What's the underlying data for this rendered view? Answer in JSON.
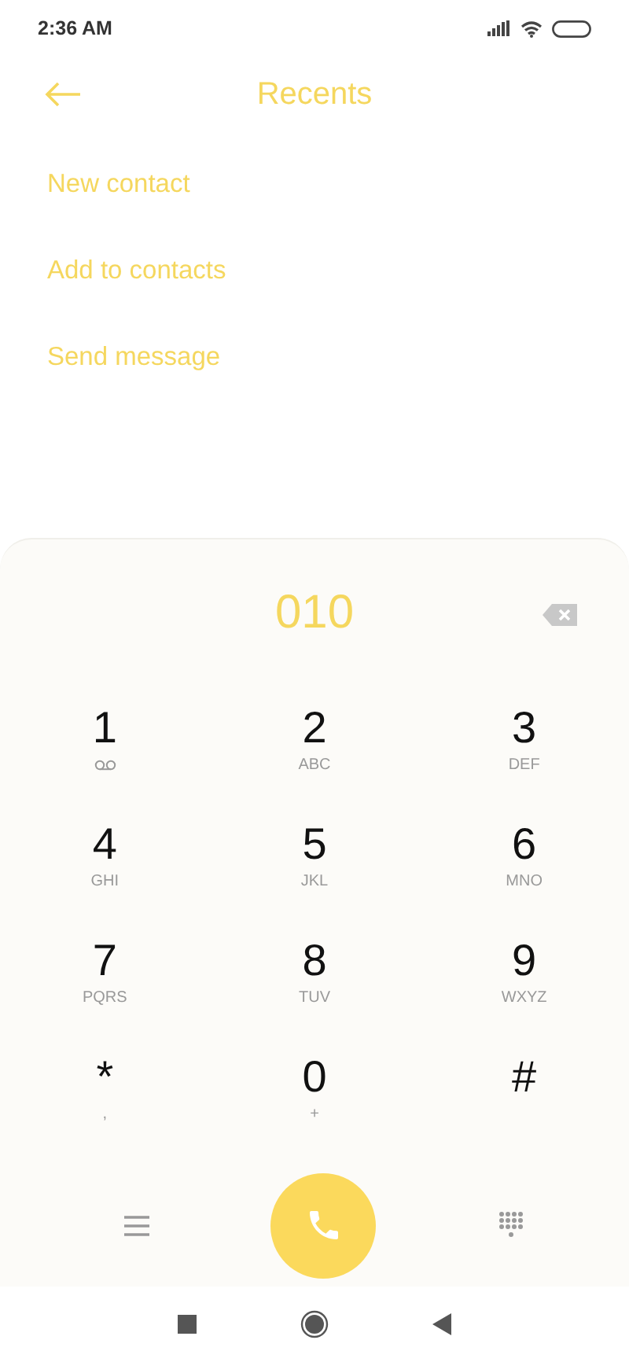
{
  "status_bar": {
    "time": "2:36 AM"
  },
  "header": {
    "title": "Recents"
  },
  "actions": [
    "New contact",
    "Add to contacts",
    "Send message"
  ],
  "dialer": {
    "number": "010",
    "keys": [
      {
        "digit": "1",
        "kind": "voicemail"
      },
      {
        "digit": "2",
        "kind": "letters",
        "sub": "ABC"
      },
      {
        "digit": "3",
        "kind": "letters",
        "sub": "DEF"
      },
      {
        "digit": "4",
        "kind": "letters",
        "sub": "GHI"
      },
      {
        "digit": "5",
        "kind": "letters",
        "sub": "JKL"
      },
      {
        "digit": "6",
        "kind": "letters",
        "sub": "MNO"
      },
      {
        "digit": "7",
        "kind": "letters",
        "sub": "PQRS"
      },
      {
        "digit": "8",
        "kind": "letters",
        "sub": "TUV"
      },
      {
        "digit": "9",
        "kind": "letters",
        "sub": "WXYZ"
      },
      {
        "digit": "*",
        "kind": "letters",
        "sub": ","
      },
      {
        "digit": "0",
        "kind": "letters",
        "sub": "+"
      },
      {
        "digit": "#",
        "kind": "letters"
      }
    ]
  }
}
